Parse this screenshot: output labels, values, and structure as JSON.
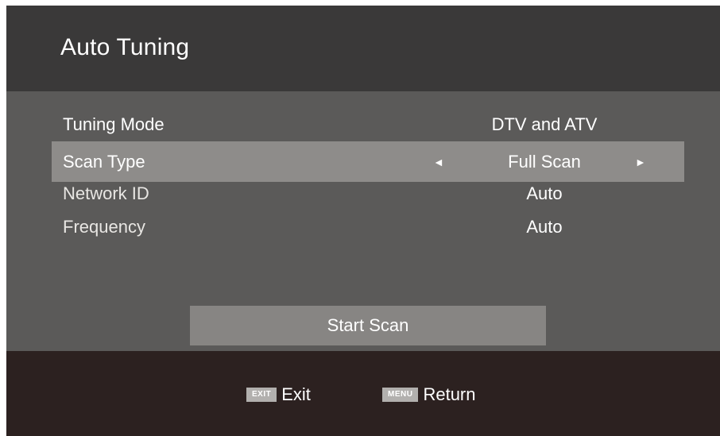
{
  "header": {
    "title": "Auto Tuning"
  },
  "menu": {
    "rows": [
      {
        "label": "Tuning Mode",
        "value": "DTV and ATV",
        "selected": false
      },
      {
        "label": "Scan Type",
        "value": "Full Scan",
        "selected": true,
        "left_arrow": "◄",
        "right_arrow": "►"
      },
      {
        "label": "Network ID",
        "value": "Auto",
        "selected": false
      },
      {
        "label": "Frequency",
        "value": "Auto",
        "selected": false
      }
    ]
  },
  "actions": {
    "start_scan_label": "Start Scan"
  },
  "footer": {
    "exit_key": "EXIT",
    "exit_label": "Exit",
    "menu_key": "MENU",
    "menu_label": "Return"
  },
  "colors": {
    "header_bg": "#3a3939",
    "body_bg": "#5b5a59",
    "selected_row_bg": "#8e8c8a",
    "button_bg": "#878583",
    "footer_bg": "#2c2120"
  }
}
